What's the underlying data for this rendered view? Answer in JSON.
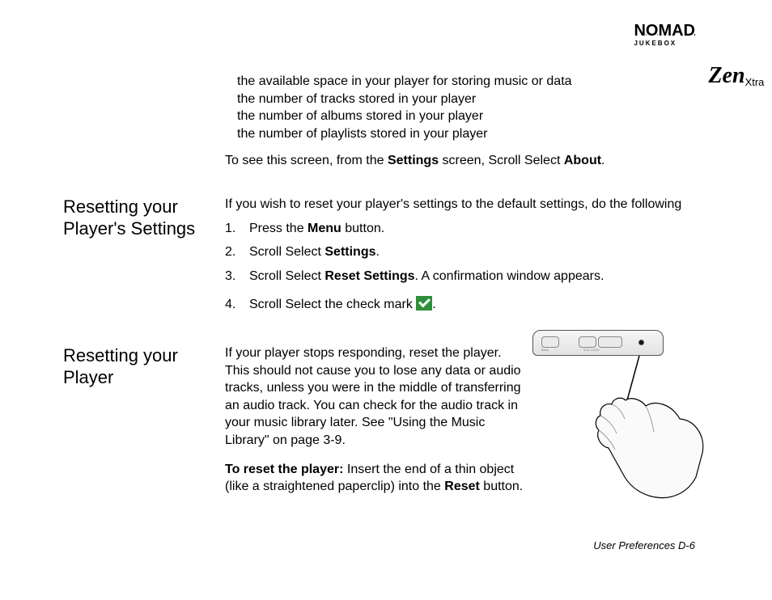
{
  "brand": {
    "line1": "NOMAD",
    "line2": "JUKEBOX",
    "zen": "Zen",
    "xtra": "Xtra"
  },
  "bullets": {
    "b1": "the available space in your player for storing music or data",
    "b2": "the number of tracks stored in your player",
    "b3": "the number of albums stored in your player",
    "b4": "the number of playlists stored in your player"
  },
  "navline": {
    "p1": "To see this screen, from the ",
    "b1": "Settings",
    "p2": " screen, Scroll Select ",
    "b2": "About",
    "p3": "."
  },
  "section1": {
    "heading": "Resetting your Player's Settings",
    "intro": "If you wish to reset your player's settings to the default settings, do the following",
    "s1a": "Press the ",
    "s1b": "Menu",
    "s1c": " button.",
    "s2a": "Scroll Select ",
    "s2b": "Settings",
    "s2c": ".",
    "s3a": "Scroll Select ",
    "s3b": "Reset Settings",
    "s3c": ". A confirmation window appears.",
    "s4a": "Scroll Select the check mark ",
    "s4c": "."
  },
  "section2": {
    "heading": "Resetting your Player",
    "para1": "If your player stops responding, reset the player. This should not cause you to lose any data or audio tracks, unless you were in the middle of transferring an audio track. You can check for the audio track in your music library later. See \"Using the Music Library\" on page 3-9.",
    "p2a": "To reset the player:",
    "p2b": " Insert the end of a thin object (like a straightened paperclip) into the ",
    "p2c": "Reset",
    "p2d": " button."
  },
  "illustration": {
    "label_back": "Back",
    "label_vol": "VOL LOCK"
  },
  "footer": "User Preferences D-6"
}
